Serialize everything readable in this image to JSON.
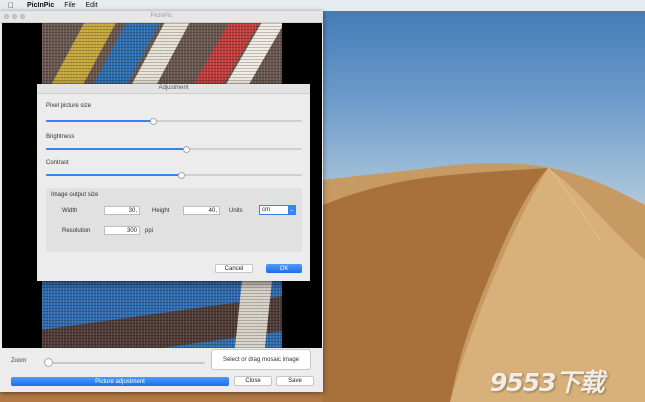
{
  "menubar": {
    "apple_icon": "apple-logo-icon",
    "items": [
      {
        "label": "PicInPic"
      },
      {
        "label": "File"
      },
      {
        "label": "Edit"
      }
    ]
  },
  "window": {
    "title": "PicInPic"
  },
  "adjustment": {
    "title": "Adjustment",
    "pixel_label": "Pixel picture size",
    "pixel_value": 0.42,
    "brightness_label": "Brightness",
    "brightness_value": 0.55,
    "contrast_label": "Contrast",
    "contrast_value": 0.53,
    "output": {
      "heading": "Image output size",
      "width_label": "Width",
      "width_value": "30,",
      "height_label": "Height",
      "height_value": "40,",
      "units_label": "Units",
      "units_value": "cm",
      "resolution_label": "Resolution",
      "resolution_value": "300",
      "resolution_unit": "ppi"
    },
    "cancel_label": "Cancel",
    "ok_label": "OK"
  },
  "bottom": {
    "zoom_label": "Zoom",
    "zoom_value": 0.0,
    "mosaic_button": "Select or drag mosaic image",
    "adjust_button": "Picture adjustment",
    "close_button": "Close",
    "save_button": "Save"
  },
  "watermark": "9553下载",
  "colors": {
    "accent": "#3b82f6",
    "button_primary": "#1f6fe9"
  }
}
